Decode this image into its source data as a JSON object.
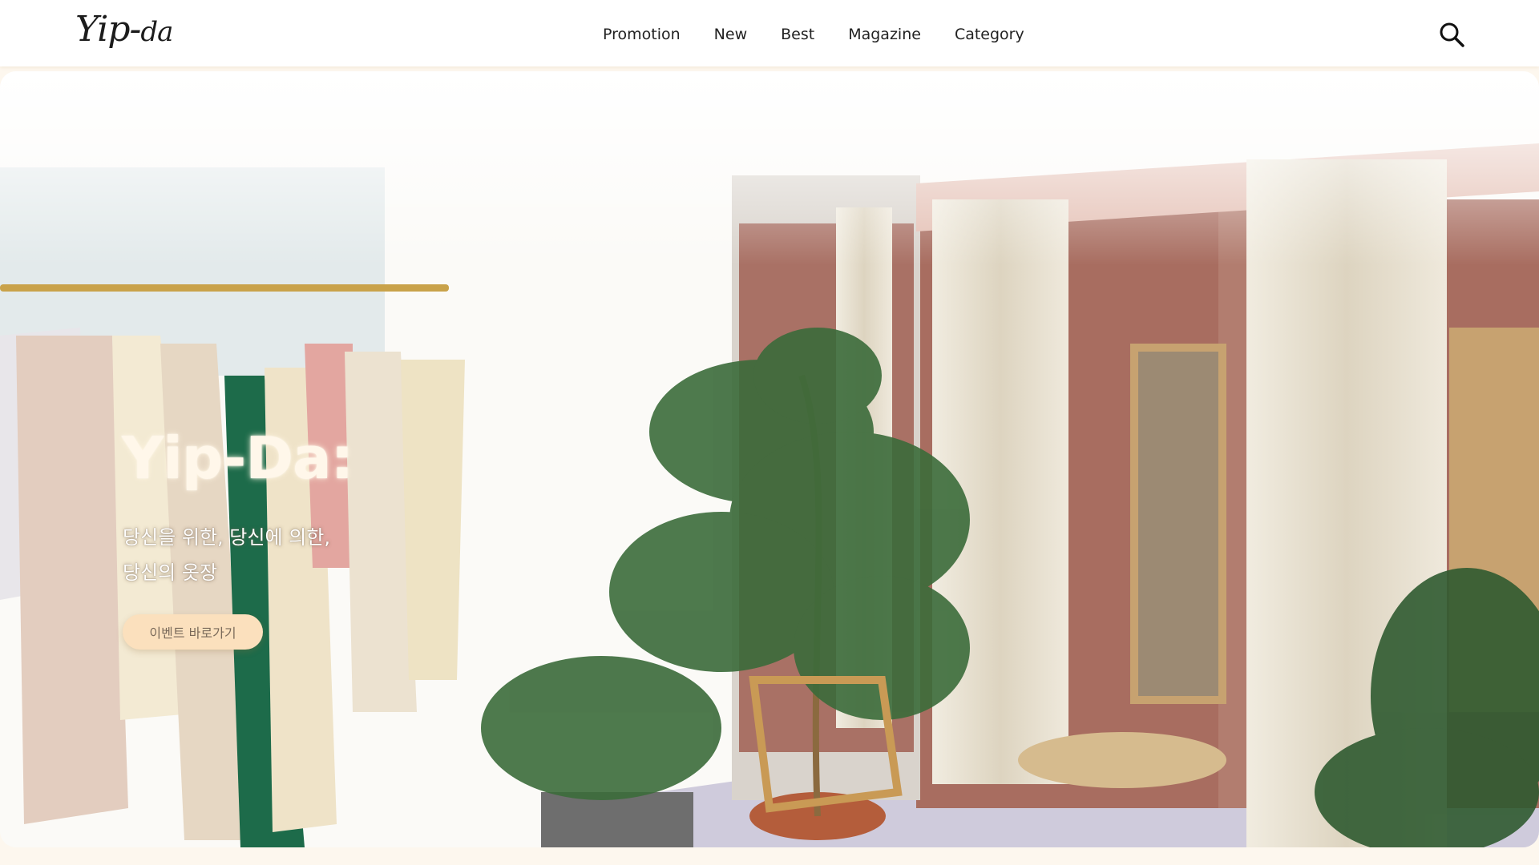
{
  "header": {
    "logo_main": "Yip-",
    "logo_small": "da",
    "nav": [
      "Promotion",
      "New",
      "Best",
      "Magazine",
      "Category"
    ],
    "search_icon": "search-icon"
  },
  "hero": {
    "title": "Yip-Da:",
    "subtitle_line1": "당신을 위한, 당신에 의한,",
    "subtitle_line2": "당신의 옷장",
    "button_label": "이벤트 바로가기",
    "image_description_icon": "hero-photo-clothing-store"
  },
  "colors": {
    "page_bg": "#fdf7ee",
    "button_bg": "#fbe0bd",
    "wall_accent": "#a86d60",
    "curtain": "#e6ddc8"
  }
}
